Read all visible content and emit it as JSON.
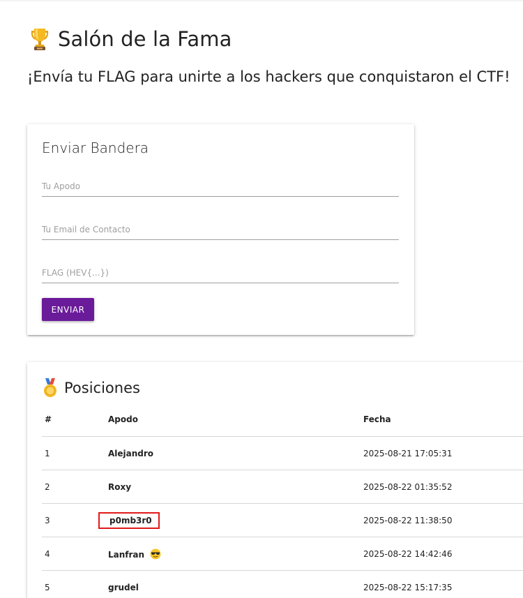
{
  "header": {
    "title": "Salón de la Fama",
    "title_icon": "trophy-icon",
    "subtitle": "¡Envía tu FLAG para unirte a los hackers que conquistaron el CTF!"
  },
  "form": {
    "title": "Enviar Bandera",
    "nickname_placeholder": "Tu Apodo",
    "email_placeholder": "Tu Email de Contacto",
    "flag_placeholder": "FLAG (HEV{...})",
    "submit_label": "ENVIAR",
    "accent": "#6a1b9a"
  },
  "rankings": {
    "title": "Posiciones",
    "title_icon": "medal-icon",
    "columns": [
      "#",
      "Apodo",
      "Fecha"
    ],
    "rows": [
      {
        "pos": "1",
        "nick": "Alejandro",
        "date": "2025-08-21 17:05:31"
      },
      {
        "pos": "2",
        "nick": "Roxy",
        "date": "2025-08-22 01:35:52"
      },
      {
        "pos": "3",
        "nick": "p0mb3r0",
        "date": "2025-08-22 11:38:50",
        "highlight_color": "#e11919"
      },
      {
        "pos": "4",
        "nick": "Lanfran",
        "nick_icon": "sunglasses-emoji-icon",
        "date": "2025-08-22 14:42:46"
      },
      {
        "pos": "5",
        "nick": "grudel",
        "date": "2025-08-22 15:17:35"
      }
    ]
  }
}
